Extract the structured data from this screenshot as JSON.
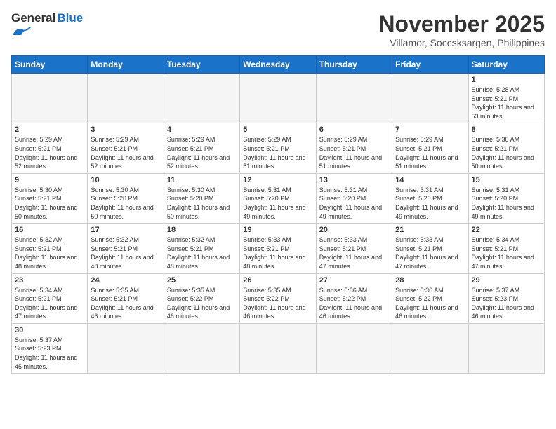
{
  "header": {
    "logo_text_general": "General",
    "logo_text_blue": "Blue",
    "month_title": "November 2025",
    "location": "Villamor, Soccsksargen, Philippines"
  },
  "weekdays": [
    "Sunday",
    "Monday",
    "Tuesday",
    "Wednesday",
    "Thursday",
    "Friday",
    "Saturday"
  ],
  "days": [
    {
      "num": "",
      "empty": true
    },
    {
      "num": "",
      "empty": true
    },
    {
      "num": "",
      "empty": true
    },
    {
      "num": "",
      "empty": true
    },
    {
      "num": "",
      "empty": true
    },
    {
      "num": "",
      "empty": true
    },
    {
      "num": "1",
      "sunrise": "5:28 AM",
      "sunset": "5:21 PM",
      "daylight": "11 hours and 53 minutes."
    },
    {
      "num": "2",
      "sunrise": "5:29 AM",
      "sunset": "5:21 PM",
      "daylight": "11 hours and 52 minutes."
    },
    {
      "num": "3",
      "sunrise": "5:29 AM",
      "sunset": "5:21 PM",
      "daylight": "11 hours and 52 minutes."
    },
    {
      "num": "4",
      "sunrise": "5:29 AM",
      "sunset": "5:21 PM",
      "daylight": "11 hours and 52 minutes."
    },
    {
      "num": "5",
      "sunrise": "5:29 AM",
      "sunset": "5:21 PM",
      "daylight": "11 hours and 51 minutes."
    },
    {
      "num": "6",
      "sunrise": "5:29 AM",
      "sunset": "5:21 PM",
      "daylight": "11 hours and 51 minutes."
    },
    {
      "num": "7",
      "sunrise": "5:29 AM",
      "sunset": "5:21 PM",
      "daylight": "11 hours and 51 minutes."
    },
    {
      "num": "8",
      "sunrise": "5:30 AM",
      "sunset": "5:21 PM",
      "daylight": "11 hours and 50 minutes."
    },
    {
      "num": "9",
      "sunrise": "5:30 AM",
      "sunset": "5:21 PM",
      "daylight": "11 hours and 50 minutes."
    },
    {
      "num": "10",
      "sunrise": "5:30 AM",
      "sunset": "5:20 PM",
      "daylight": "11 hours and 50 minutes."
    },
    {
      "num": "11",
      "sunrise": "5:30 AM",
      "sunset": "5:20 PM",
      "daylight": "11 hours and 50 minutes."
    },
    {
      "num": "12",
      "sunrise": "5:31 AM",
      "sunset": "5:20 PM",
      "daylight": "11 hours and 49 minutes."
    },
    {
      "num": "13",
      "sunrise": "5:31 AM",
      "sunset": "5:20 PM",
      "daylight": "11 hours and 49 minutes."
    },
    {
      "num": "14",
      "sunrise": "5:31 AM",
      "sunset": "5:20 PM",
      "daylight": "11 hours and 49 minutes."
    },
    {
      "num": "15",
      "sunrise": "5:31 AM",
      "sunset": "5:20 PM",
      "daylight": "11 hours and 49 minutes."
    },
    {
      "num": "16",
      "sunrise": "5:32 AM",
      "sunset": "5:21 PM",
      "daylight": "11 hours and 48 minutes."
    },
    {
      "num": "17",
      "sunrise": "5:32 AM",
      "sunset": "5:21 PM",
      "daylight": "11 hours and 48 minutes."
    },
    {
      "num": "18",
      "sunrise": "5:32 AM",
      "sunset": "5:21 PM",
      "daylight": "11 hours and 48 minutes."
    },
    {
      "num": "19",
      "sunrise": "5:33 AM",
      "sunset": "5:21 PM",
      "daylight": "11 hours and 48 minutes."
    },
    {
      "num": "20",
      "sunrise": "5:33 AM",
      "sunset": "5:21 PM",
      "daylight": "11 hours and 47 minutes."
    },
    {
      "num": "21",
      "sunrise": "5:33 AM",
      "sunset": "5:21 PM",
      "daylight": "11 hours and 47 minutes."
    },
    {
      "num": "22",
      "sunrise": "5:34 AM",
      "sunset": "5:21 PM",
      "daylight": "11 hours and 47 minutes."
    },
    {
      "num": "23",
      "sunrise": "5:34 AM",
      "sunset": "5:21 PM",
      "daylight": "11 hours and 47 minutes."
    },
    {
      "num": "24",
      "sunrise": "5:35 AM",
      "sunset": "5:21 PM",
      "daylight": "11 hours and 46 minutes."
    },
    {
      "num": "25",
      "sunrise": "5:35 AM",
      "sunset": "5:22 PM",
      "daylight": "11 hours and 46 minutes."
    },
    {
      "num": "26",
      "sunrise": "5:35 AM",
      "sunset": "5:22 PM",
      "daylight": "11 hours and 46 minutes."
    },
    {
      "num": "27",
      "sunrise": "5:36 AM",
      "sunset": "5:22 PM",
      "daylight": "11 hours and 46 minutes."
    },
    {
      "num": "28",
      "sunrise": "5:36 AM",
      "sunset": "5:22 PM",
      "daylight": "11 hours and 46 minutes."
    },
    {
      "num": "29",
      "sunrise": "5:37 AM",
      "sunset": "5:23 PM",
      "daylight": "11 hours and 46 minutes."
    },
    {
      "num": "30",
      "sunrise": "5:37 AM",
      "sunset": "5:23 PM",
      "daylight": "11 hours and 45 minutes."
    },
    {
      "num": "",
      "empty": true
    },
    {
      "num": "",
      "empty": true
    },
    {
      "num": "",
      "empty": true
    },
    {
      "num": "",
      "empty": true
    },
    {
      "num": "",
      "empty": true
    },
    {
      "num": "",
      "empty": true
    }
  ],
  "labels": {
    "sunrise": "Sunrise:",
    "sunset": "Sunset:",
    "daylight": "Daylight:"
  }
}
